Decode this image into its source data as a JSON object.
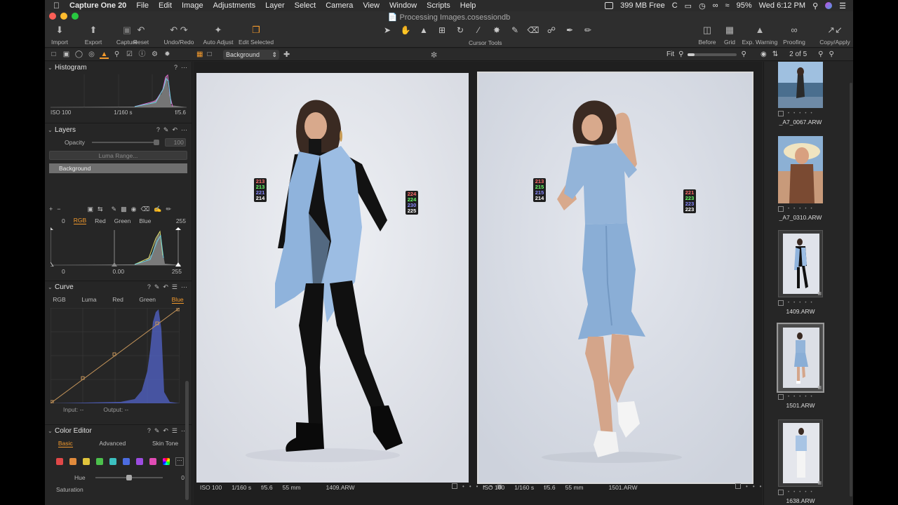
{
  "menubar": {
    "app": "Capture One 20",
    "items": [
      "File",
      "Edit",
      "Image",
      "Adjustments",
      "Layer",
      "Select",
      "Camera",
      "View",
      "Window",
      "Scripts",
      "Help"
    ],
    "memory": "399 MB Free",
    "battery": "95%",
    "clock": "Wed 6:12 PM"
  },
  "window": {
    "title": "Processing Images.cosessiondb"
  },
  "toolbar": {
    "left": [
      "Import",
      "Export",
      "Capture"
    ],
    "undo": [
      "Reset",
      "Undo/Redo"
    ],
    "adjust": [
      "Auto Adjust",
      "Edit Selected"
    ],
    "cursor_tools_label": "Cursor Tools",
    "right": [
      "Before",
      "Grid",
      "Exp. Warning",
      "Proofing",
      "Copy/Apply"
    ]
  },
  "viewer_bar": {
    "variant": "Background",
    "zoom_label": "Fit",
    "count": "2 of 5"
  },
  "histogram": {
    "title": "Histogram",
    "iso": "ISO 100",
    "shutter": "1/160 s",
    "aperture": "f/5.6"
  },
  "layers": {
    "title": "Layers",
    "opacity_label": "Opacity",
    "opacity_value": "100",
    "luma_button": "Luma Range...",
    "items": [
      "Background"
    ]
  },
  "levels": {
    "min": "0",
    "max": "255",
    "tabs": [
      "RGB",
      "Red",
      "Green",
      "Blue"
    ],
    "active_tab": "RGB",
    "out_min": "0",
    "mid": "0.00",
    "out_max": "255"
  },
  "curve": {
    "title": "Curve",
    "tabs": [
      "RGB",
      "Luma",
      "Red",
      "Green",
      "Blue"
    ],
    "active_tab": "Blue",
    "input_label": "Input:",
    "input_value": "--",
    "output_label": "Output:",
    "output_value": "--"
  },
  "color_editor": {
    "title": "Color Editor",
    "tabs": [
      "Basic",
      "Advanced",
      "Skin Tone"
    ],
    "active_tab": "Basic",
    "hue_label": "Hue",
    "hue_value": "0",
    "saturation_label": "Saturation",
    "swatches": [
      "#e04848",
      "#e08a3c",
      "#e0c43c",
      "#4cc04c",
      "#3cc0c0",
      "#4c6ce0",
      "#9c4ce0",
      "#e04cb4"
    ]
  },
  "photos": [
    {
      "iso": "ISO 100",
      "shutter": "1/160 s",
      "aperture": "f/5.6",
      "focal": "55 mm",
      "file": "1409.ARW",
      "pickers": [
        {
          "r": "213",
          "g": "213",
          "b": "221",
          "l": "214"
        },
        {
          "r": "224",
          "g": "224",
          "b": "230",
          "l": "225"
        }
      ]
    },
    {
      "iso": "ISO 100",
      "shutter": "1/160 s",
      "aperture": "f/5.6",
      "focal": "55 mm",
      "file": "1501.ARW",
      "pickers": [
        {
          "r": "213",
          "g": "215",
          "b": "215",
          "l": "214"
        },
        {
          "r": "221",
          "g": "223",
          "b": "223",
          "l": "223"
        }
      ]
    }
  ],
  "browser": {
    "thumbs": [
      "_A7_0067.ARW",
      "_A7_0310.ARW",
      "1409.ARW",
      "1501.ARW",
      "1638.ARW"
    ]
  }
}
